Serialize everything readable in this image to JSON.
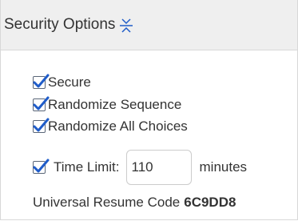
{
  "panel": {
    "title": "Security Options",
    "collapse_icon": "collapse-icon"
  },
  "options": {
    "secure": {
      "label": "Secure",
      "checked": true
    },
    "randomize_sequence": {
      "label": "Randomize Sequence",
      "checked": true
    },
    "randomize_all_choices": {
      "label": "Randomize All Choices",
      "checked": true
    },
    "time_limit": {
      "label": "Time Limit:",
      "checked": true,
      "value": "110",
      "unit": "minutes"
    }
  },
  "resume": {
    "label": "Universal Resume Code",
    "code": "6C9DD8"
  },
  "colors": {
    "check": "#1f5cc9",
    "header_bg": "#efefef"
  }
}
